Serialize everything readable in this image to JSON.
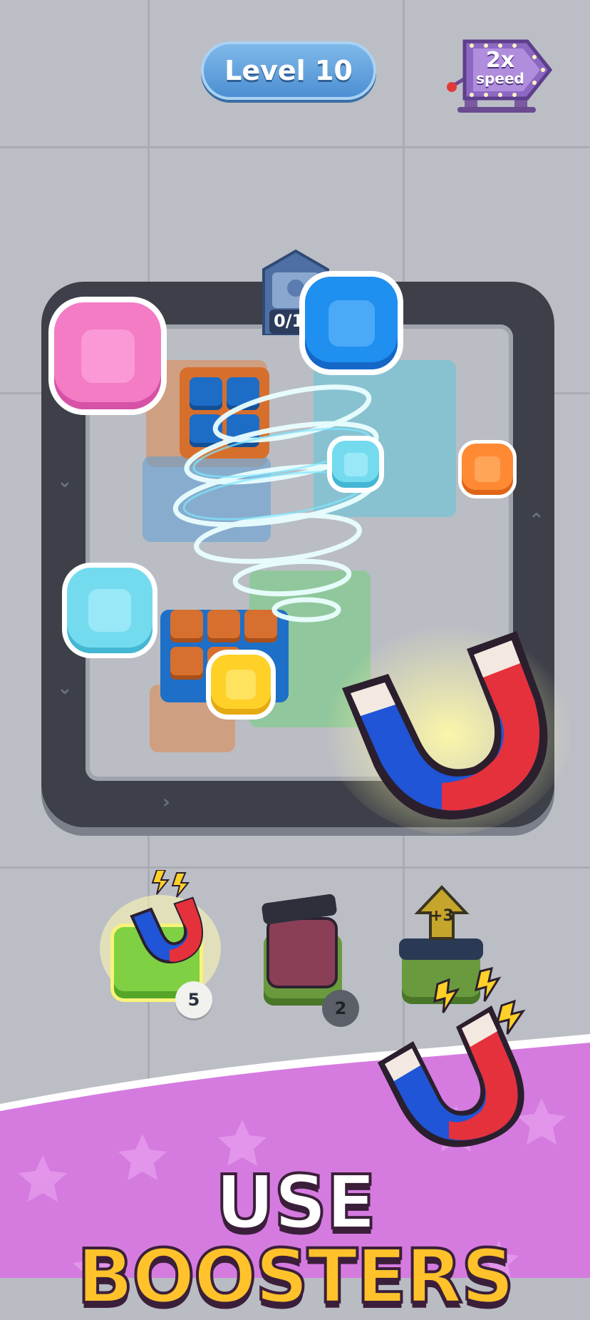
{
  "header": {
    "level_label": "Level 10",
    "speed_multiplier": "2x",
    "speed_label": "speed"
  },
  "board": {
    "counter_text": "0/1"
  },
  "boosters": [
    {
      "name": "magnet",
      "count": "5",
      "selected": true
    },
    {
      "name": "shuffle",
      "count": "2",
      "selected": false
    },
    {
      "name": "extra-slots",
      "badge": "+3",
      "selected": false
    }
  ],
  "banner": {
    "word1": "USE",
    "word2": "BOOSTERS"
  }
}
